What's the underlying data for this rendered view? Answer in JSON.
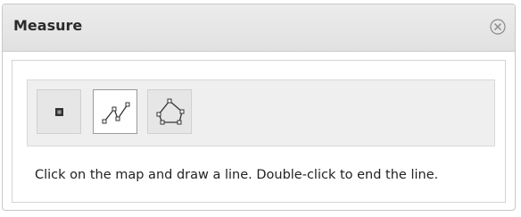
{
  "window": {
    "title": "Measure",
    "close_icon": "close-circle-x-icon"
  },
  "toolbar": {
    "tools": [
      {
        "id": "point",
        "icon": "measure-point-icon",
        "selected": false
      },
      {
        "id": "line",
        "icon": "measure-line-icon",
        "selected": true
      },
      {
        "id": "area",
        "icon": "measure-area-icon",
        "selected": false
      }
    ]
  },
  "instructions": {
    "text": "Click on the map and draw a line. Double-click to end the line."
  },
  "colors": {
    "header_bg": "#e6e6e6",
    "toolbar_bg": "#efefef",
    "selected_tool_bg": "#ffffff",
    "text": "#222222"
  }
}
